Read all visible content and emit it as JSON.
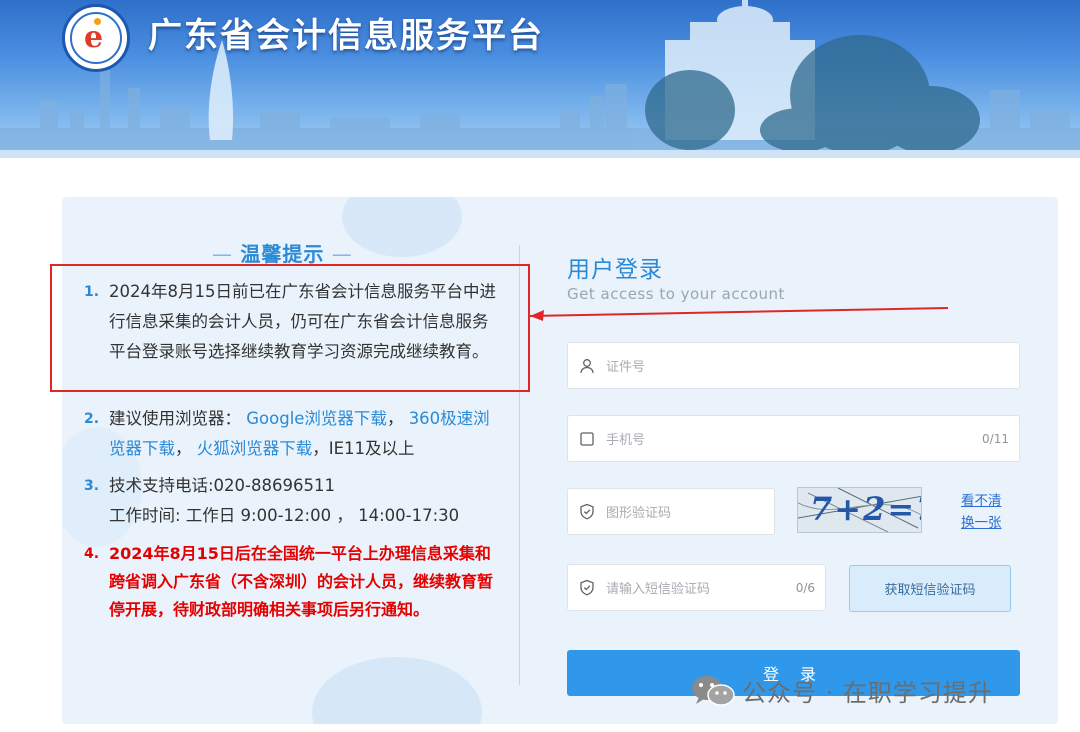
{
  "header": {
    "site_title": "广东省会计信息服务平台",
    "logo_icon": "ring-e-logo-icon"
  },
  "notice": {
    "heading": "温馨提示",
    "items": [
      {
        "num": "1.",
        "text": "2024年8月15日前已在广东省会计信息服务平台中进行信息采集的会计人员，仍可在广东省会计信息服务平台登录账号选择继续教育学习资源完成继续教育。"
      },
      {
        "num": "2.",
        "prefix": "建议使用浏览器：",
        "links": [
          "Google浏览器下载",
          "360极速浏览器下载",
          "火狐浏览器下载"
        ],
        "suffix": "IE11及以上"
      },
      {
        "num": "3.",
        "line1": "技术支持电话:020-88696511",
        "line2": "工作时间: 工作日 9:00-12:00 ， 14:00-17:30"
      },
      {
        "num": "4.",
        "text": "2024年8月15日后在全国统一平台上办理信息采集和跨省调入广东省（不含深圳）的会计人员，继续教育暂停开展，待财政部明确相关事项后另行通知。"
      }
    ]
  },
  "login": {
    "title": "用户登录",
    "subtitle": "Get access to your account",
    "id_placeholder": "证件号",
    "phone_placeholder": "手机号",
    "phone_count": "0/11",
    "captcha_placeholder": "图形验证码",
    "captcha_image_text": "7+2=?",
    "refresh_line1": "看不清",
    "refresh_line2": "换一张",
    "sms_placeholder": "请输入短信验证码",
    "sms_count": "0/6",
    "sms_button": "获取短信验证码",
    "login_button": "登 录"
  },
  "watermark": {
    "text": "公众号 · 在职学习提升"
  },
  "colors": {
    "accent": "#2a8ad6",
    "warning": "#e50000",
    "login_button": "#2f98ea",
    "annotation": "#e02626"
  }
}
